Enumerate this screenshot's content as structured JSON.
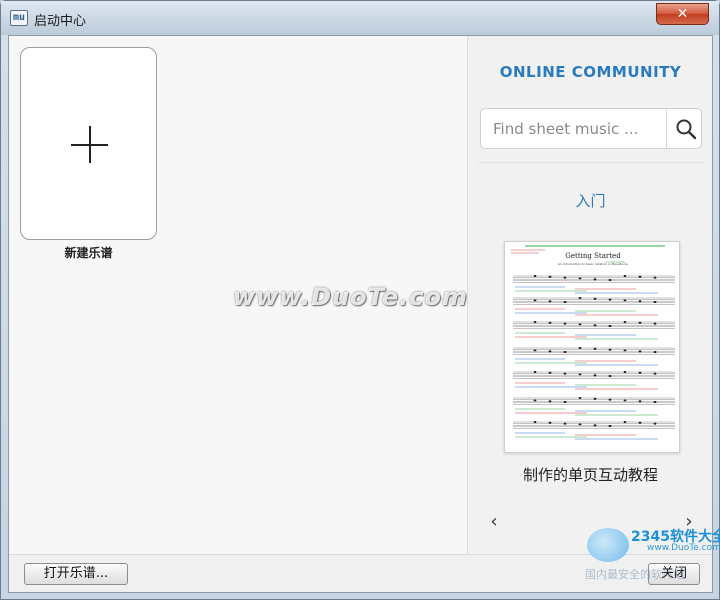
{
  "window": {
    "title": "启动中心",
    "icon_text": "mu",
    "close_glyph": "✕"
  },
  "left_panel": {
    "new_score_label": "新建乐谱"
  },
  "right_panel": {
    "heading": "ONLINE COMMUNITY",
    "search": {
      "placeholder": "Find sheet music ..."
    },
    "section_title": "入门",
    "tutorial": {
      "caption": "制作的单页互动教程",
      "doc_title": "Getting Started",
      "doc_subtitle": "An introduction to basic notation in MuseScore"
    },
    "nav": {
      "prev": "‹",
      "next": "›"
    }
  },
  "footer": {
    "open_score_label": "打开乐谱...",
    "close_label": "关闭"
  },
  "watermarks": {
    "main": "www.DuoTe.com",
    "logo": "2345软件大全",
    "logo_url": "www.DuoTe.com",
    "sub": "国内最安全的软件站"
  },
  "colors": {
    "accent": "#2a7bbd",
    "close_button": "#c23d1f"
  }
}
